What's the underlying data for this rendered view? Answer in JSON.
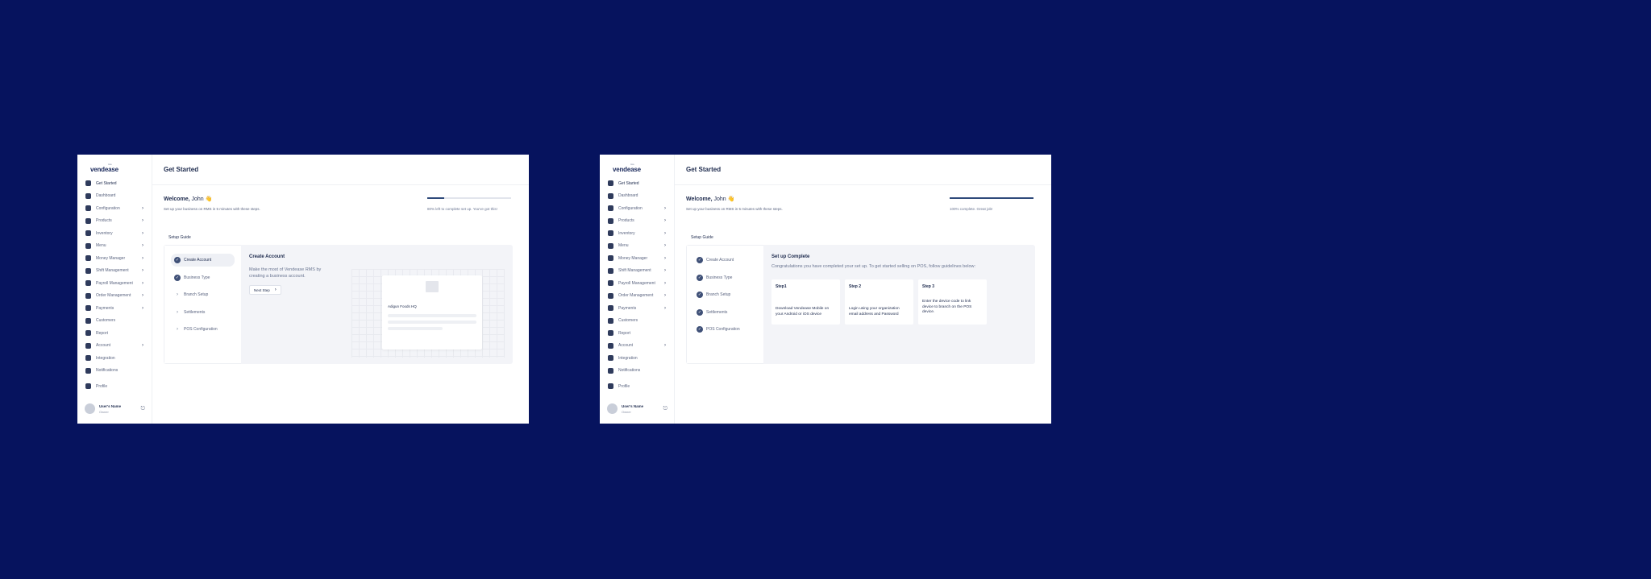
{
  "screens": [
    {
      "logo": "vendease",
      "logo_sub": "rms",
      "nav": [
        {
          "label": "Get Started",
          "icon": "house-icon",
          "chevron": false
        },
        {
          "label": "Dashboard",
          "icon": "grid-icon",
          "chevron": false
        },
        {
          "label": "Configuration",
          "icon": "check-square-icon",
          "chevron": true
        },
        {
          "label": "Products",
          "icon": "box-icon",
          "chevron": true
        },
        {
          "label": "Inventory",
          "icon": "inventory-icon",
          "chevron": true
        },
        {
          "label": "Menu",
          "icon": "menu-book-icon",
          "chevron": true
        },
        {
          "label": "Money Manager",
          "icon": "wallet-icon",
          "chevron": true
        },
        {
          "label": "Shift Management",
          "icon": "shift-icon",
          "chevron": true
        },
        {
          "label": "Payroll Management",
          "icon": "payroll-icon",
          "chevron": true
        },
        {
          "label": "Order Management",
          "icon": "order-icon",
          "chevron": true
        },
        {
          "label": "Payments",
          "icon": "card-icon",
          "chevron": true
        },
        {
          "label": "Customers",
          "icon": "customers-icon",
          "chevron": false
        },
        {
          "label": "Report",
          "icon": "report-icon",
          "chevron": false
        },
        {
          "label": "Account",
          "icon": "account-icon",
          "chevron": true
        },
        {
          "label": "Integration",
          "icon": "plug-icon",
          "chevron": false
        },
        {
          "label": "Notifications",
          "icon": "bell-icon",
          "chevron": false
        }
      ],
      "profile": "Profile",
      "user_name": "User's Name",
      "user_role": "Owner",
      "page_title": "Get Started",
      "welcome_prefix": "Welcome,",
      "welcome_name": "John 👋",
      "tagline": "Set up your business on RMS in 5 minutes with these steps.",
      "progress": 0.2,
      "progress_text": "80% left to complete set up. You've got this!",
      "guide_title": "Setup Guide",
      "steps": [
        {
          "label": "Create Account",
          "state": "done"
        },
        {
          "label": "Business Type",
          "state": "done"
        },
        {
          "label": "Branch Setup",
          "state": "pending"
        },
        {
          "label": "Settlements",
          "state": "pending"
        },
        {
          "label": "POS Configuration",
          "state": "pending"
        }
      ],
      "content_title": "Create Account",
      "content_desc": "Make the most of Vendease RMS by creating a business account.",
      "next_label": "Next Step",
      "mock_name": "Adigun Foods HQ"
    },
    {
      "logo": "vendease",
      "logo_sub": "rms",
      "nav": [
        {
          "label": "Get Started",
          "icon": "house-icon",
          "chevron": false
        },
        {
          "label": "Dashboard",
          "icon": "grid-icon",
          "chevron": false
        },
        {
          "label": "Configuration",
          "icon": "check-square-icon",
          "chevron": true
        },
        {
          "label": "Products",
          "icon": "box-icon",
          "chevron": true
        },
        {
          "label": "Inventory",
          "icon": "inventory-icon",
          "chevron": true
        },
        {
          "label": "Menu",
          "icon": "menu-book-icon",
          "chevron": true
        },
        {
          "label": "Money Manager",
          "icon": "wallet-icon",
          "chevron": true
        },
        {
          "label": "Shift Management",
          "icon": "shift-icon",
          "chevron": true
        },
        {
          "label": "Payroll Management",
          "icon": "payroll-icon",
          "chevron": true
        },
        {
          "label": "Order Management",
          "icon": "order-icon",
          "chevron": true
        },
        {
          "label": "Payments",
          "icon": "card-icon",
          "chevron": true
        },
        {
          "label": "Customers",
          "icon": "customers-icon",
          "chevron": false
        },
        {
          "label": "Report",
          "icon": "report-icon",
          "chevron": false
        },
        {
          "label": "Account",
          "icon": "account-icon",
          "chevron": true
        },
        {
          "label": "Integration",
          "icon": "plug-icon",
          "chevron": false
        },
        {
          "label": "Notifications",
          "icon": "bell-icon",
          "chevron": false
        }
      ],
      "profile": "Profile",
      "user_name": "User's Name",
      "user_role": "Owner",
      "page_title": "Get Started",
      "welcome_prefix": "Welcome,",
      "welcome_name": "John 👋",
      "tagline": "Set up your business on RMS in 5 minutes with these steps.",
      "progress": 1.0,
      "progress_text": "100% complete. Great job!",
      "guide_title": "Setup Guide",
      "steps": [
        {
          "label": "Create Account",
          "state": "done"
        },
        {
          "label": "Business Type",
          "state": "done"
        },
        {
          "label": "Branch Setup",
          "state": "done"
        },
        {
          "label": "Settlements",
          "state": "done"
        },
        {
          "label": "POS Configuration",
          "state": "done"
        }
      ],
      "complete_title": "Set up Complete",
      "complete_desc": "Congratulations you have completed your set up. To get started selling on POS, follow guidelines below:",
      "cards": [
        {
          "title": "Step1",
          "body": "Download Vendease Mobile on your Android or iOS device"
        },
        {
          "title": "Step 2",
          "body": "Login using your organization email address and Password"
        },
        {
          "title": "Step 3",
          "body": "Enter the device code to link device to branch on the POS device."
        }
      ]
    }
  ],
  "colors": {
    "background": "#06135e",
    "accent": "#2f4a7a",
    "check": "#3f5077"
  }
}
